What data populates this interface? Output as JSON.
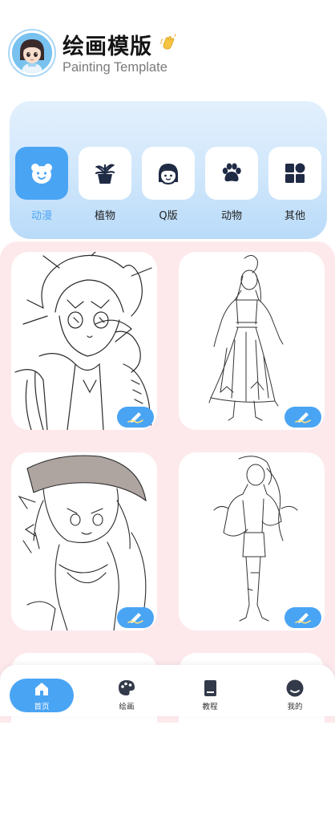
{
  "header": {
    "title": "绘画模版",
    "subtitle": "Painting Template",
    "wave_emoji": "👏"
  },
  "categories": [
    {
      "label": "动漫",
      "icon": "bear-face-icon",
      "active": true
    },
    {
      "label": "植物",
      "icon": "potted-plant-icon",
      "active": false
    },
    {
      "label": "Q版",
      "icon": "girl-face-icon",
      "active": false
    },
    {
      "label": "动物",
      "icon": "paw-icon",
      "active": false
    },
    {
      "label": "其他",
      "icon": "grid-shapes-icon",
      "active": false
    }
  ],
  "gallery": {
    "items": [
      {
        "subject": "anime boy with glasses",
        "icon": "pen-icon"
      },
      {
        "subject": "hanfu girl",
        "icon": "pen-icon"
      },
      {
        "subject": "fox girl with hat",
        "icon": "pen-icon"
      },
      {
        "subject": "girl in jacket",
        "icon": "pen-icon"
      }
    ]
  },
  "tabbar": {
    "items": [
      {
        "label": "首页",
        "icon": "home-icon",
        "active": true
      },
      {
        "label": "绘画",
        "icon": "palette-icon",
        "active": false
      },
      {
        "label": "教程",
        "icon": "book-icon",
        "active": false
      },
      {
        "label": "我的",
        "icon": "profile-icon",
        "active": false
      }
    ]
  },
  "colors": {
    "accent": "#4aa4f4",
    "panel_gradient_top": "#e3f0fd",
    "panel_gradient_bottom": "#b9dbf9",
    "gallery_bg": "#fde9ec",
    "icon_dark": "#1f2a44"
  }
}
